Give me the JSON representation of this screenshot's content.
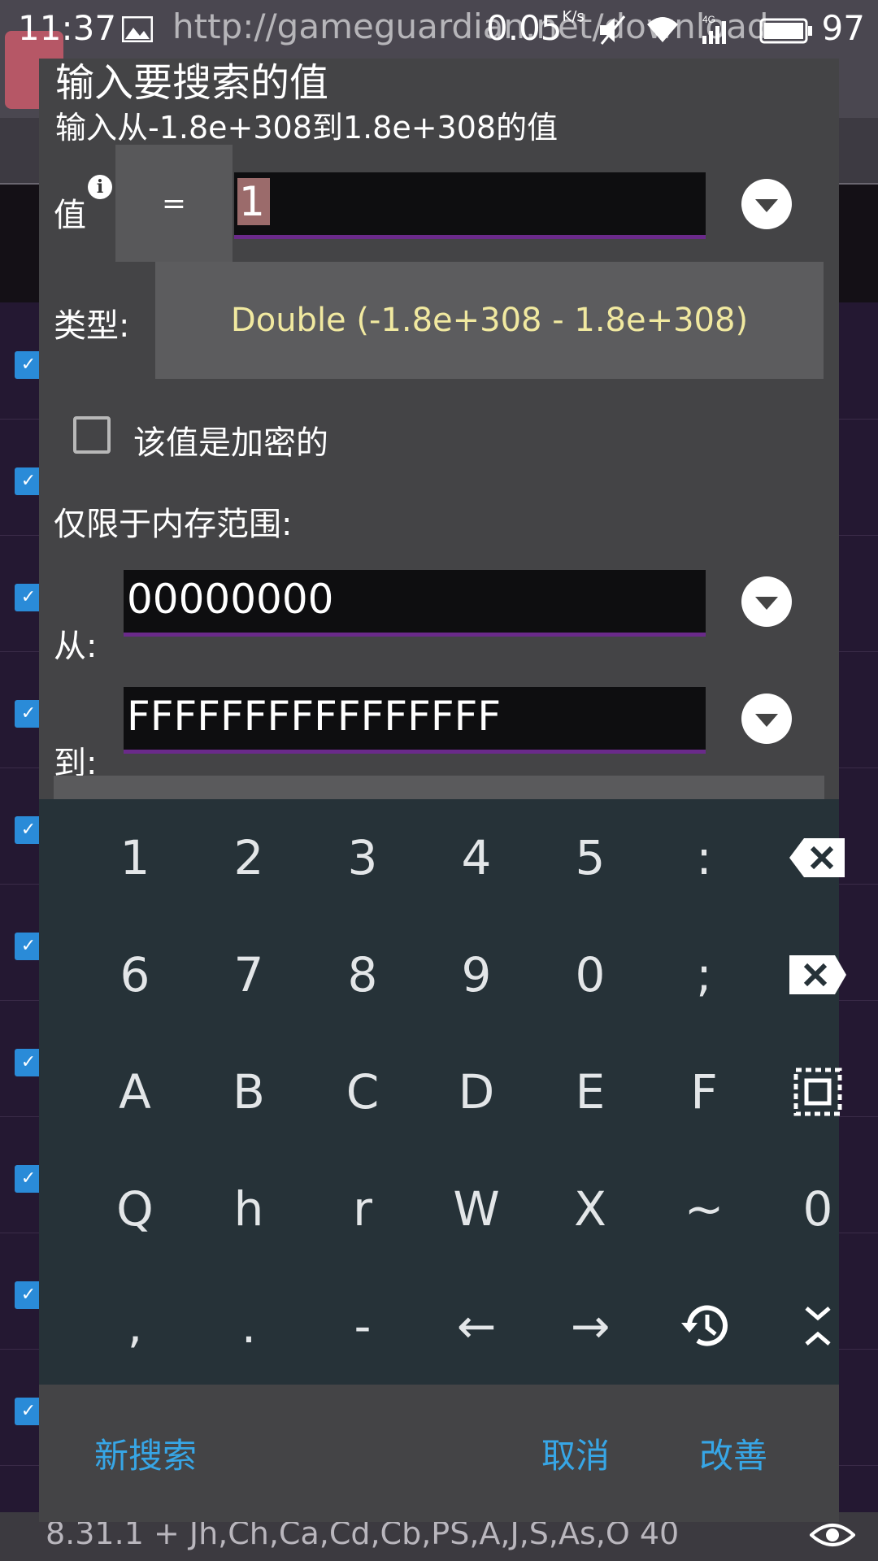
{
  "status_bar": {
    "time": "11:37",
    "url_text": "http://gameguardian.net/download",
    "network_speed": "0.05",
    "network_unit": "K/s",
    "battery_percent": "97",
    "icons": [
      "image-icon",
      "mute-icon",
      "wifi-icon",
      "signal-4g-icon",
      "battery-icon"
    ]
  },
  "background_app": {
    "footer_text": "8.31.1  +  Jh,Ch,Ca,Cd,Cb,PS,A,J,S,As,O  40"
  },
  "dialog": {
    "title": "输入要搜索的值",
    "subtitle": "输入从-1.8e+308到1.8e+308的值",
    "value_label": "值",
    "operator": "=",
    "value_input": "1",
    "type_label": "类型:",
    "type_value": "Double (-1.8e+308 - 1.8e+308)",
    "encrypted_label": "该值是加密的",
    "encrypted_checked": false,
    "range_label": "仅限于内存范围:",
    "from_label": "从:",
    "from_value": "00000000",
    "to_label": "到:",
    "to_value": "FFFFFFFFFFFFFFFF"
  },
  "keyboard": {
    "rows": [
      [
        "1",
        "2",
        "3",
        "4",
        "5",
        ":",
        "backspace-icon"
      ],
      [
        "6",
        "7",
        "8",
        "9",
        "0",
        ";",
        "clear-icon"
      ],
      [
        "A",
        "B",
        "C",
        "D",
        "E",
        "F",
        "select-all-icon"
      ],
      [
        "Q",
        "h",
        "r",
        "W",
        "X",
        "~",
        "0"
      ],
      [
        ",",
        ".",
        "-",
        "←",
        "→",
        "history-icon",
        "collapse-icon"
      ]
    ]
  },
  "actions": {
    "new_search": "新搜索",
    "cancel": "取消",
    "refine": "改善"
  },
  "colors": {
    "accent_link": "#37a6e6",
    "input_underline": "#6a2a8a",
    "type_text": "#f1e9a0",
    "keyboard_bg": "#263238",
    "dialog_bg": "#444446"
  }
}
